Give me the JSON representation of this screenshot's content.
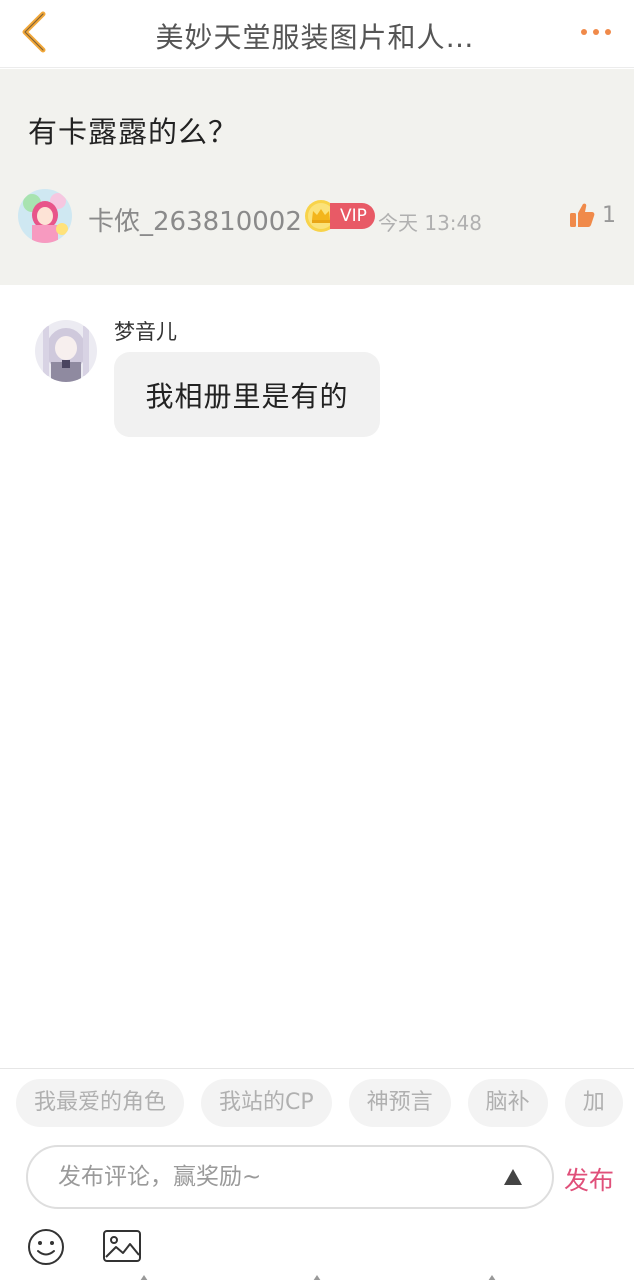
{
  "header": {
    "title": "美妙天堂服装图片和人…",
    "back_icon": "chevron-left-icon",
    "more_icon": "more-dots-icon",
    "back_color": "#f2a83a",
    "more_color": "#f08a4a"
  },
  "post": {
    "text": "有卡露露的么？",
    "username": "卡侬_263810002",
    "vip_label": "VIP",
    "time": "今天 13:48",
    "like_count": "1",
    "like_color": "#f08a4a"
  },
  "comments": [
    {
      "username": "梦音儿",
      "text": "我相册里是有的"
    }
  ],
  "quick_tags": [
    "我最爱的角色",
    "我站的CP",
    "神预言",
    "脑补",
    "加"
  ],
  "input": {
    "placeholder": "发布评论，赢奖励~",
    "send_label": "发布",
    "send_color": "#e0507a"
  }
}
